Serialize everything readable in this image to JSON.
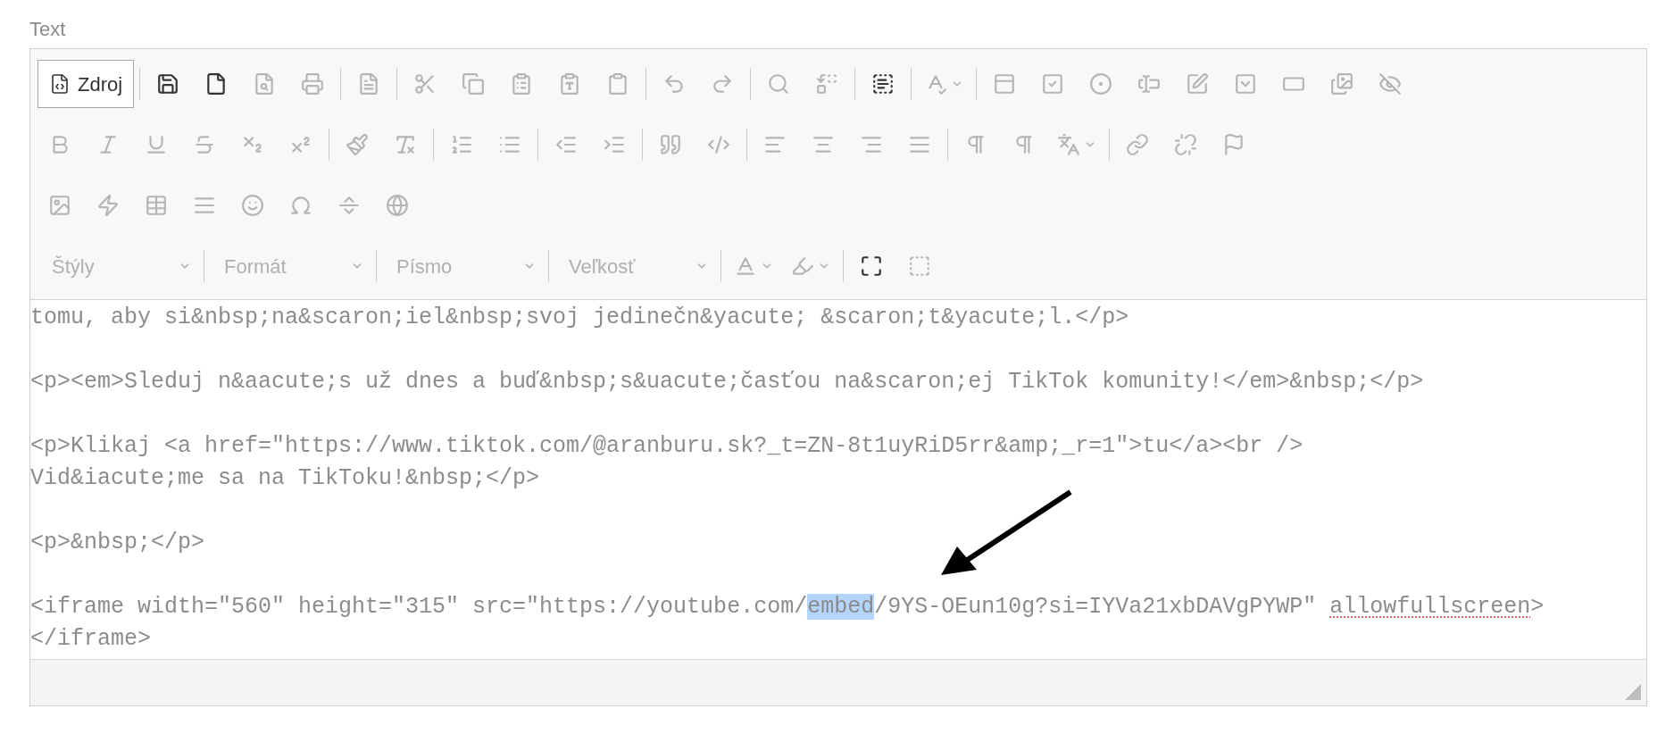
{
  "field_label": "Text",
  "toolbar": {
    "rows": [
      {
        "groups": [
          {
            "items": [
              {
                "kind": "source",
                "label": "Zdroj",
                "on": true,
                "disabled": false
              }
            ]
          },
          {
            "items": [
              {
                "kind": "icon",
                "disabled": false
              },
              {
                "kind": "icon",
                "disabled": false
              },
              {
                "kind": "icon",
                "disabled": true
              },
              {
                "kind": "icon",
                "disabled": true
              }
            ]
          },
          {
            "items": [
              {
                "kind": "icon",
                "disabled": true
              }
            ]
          },
          {
            "items": [
              {
                "kind": "icon",
                "disabled": true
              },
              {
                "kind": "icon",
                "disabled": true
              },
              {
                "kind": "icon",
                "disabled": true
              },
              {
                "kind": "icon",
                "disabled": true
              },
              {
                "kind": "icon",
                "disabled": true
              }
            ]
          },
          {
            "items": [
              {
                "kind": "icon",
                "disabled": true
              },
              {
                "kind": "icon",
                "disabled": true
              }
            ]
          },
          {
            "items": [
              {
                "kind": "icon",
                "disabled": true
              },
              {
                "kind": "icon",
                "disabled": true
              }
            ]
          },
          {
            "items": [
              {
                "kind": "icon",
                "disabled": false
              }
            ]
          },
          {
            "items": [
              {
                "kind": "menu",
                "disabled": true
              }
            ]
          },
          {
            "items": [
              {
                "kind": "icon",
                "disabled": true
              },
              {
                "kind": "icon",
                "disabled": true
              },
              {
                "kind": "icon",
                "disabled": true
              },
              {
                "kind": "icon",
                "disabled": true
              },
              {
                "kind": "icon",
                "disabled": true
              },
              {
                "kind": "icon",
                "disabled": true
              },
              {
                "kind": "icon",
                "disabled": true
              },
              {
                "kind": "icon",
                "disabled": true
              },
              {
                "kind": "icon",
                "disabled": true
              }
            ]
          }
        ]
      },
      {
        "groups": [
          {
            "items": [
              {
                "kind": "icon",
                "disabled": true
              },
              {
                "kind": "icon",
                "disabled": true
              },
              {
                "kind": "icon",
                "disabled": true
              },
              {
                "kind": "icon",
                "disabled": true
              },
              {
                "kind": "icon",
                "disabled": true
              },
              {
                "kind": "icon",
                "disabled": true
              }
            ]
          },
          {
            "items": [
              {
                "kind": "icon",
                "disabled": true
              },
              {
                "kind": "icon",
                "disabled": true
              }
            ]
          },
          {
            "items": [
              {
                "kind": "icon",
                "disabled": true
              },
              {
                "kind": "icon",
                "disabled": true
              }
            ]
          },
          {
            "items": [
              {
                "kind": "icon",
                "disabled": true
              },
              {
                "kind": "icon",
                "disabled": true
              }
            ]
          },
          {
            "items": [
              {
                "kind": "icon",
                "disabled": true
              },
              {
                "kind": "icon",
                "disabled": true
              }
            ]
          },
          {
            "items": [
              {
                "kind": "icon",
                "disabled": true
              },
              {
                "kind": "icon",
                "disabled": true
              },
              {
                "kind": "icon",
                "disabled": true
              },
              {
                "kind": "icon",
                "disabled": true
              }
            ]
          },
          {
            "items": [
              {
                "kind": "icon",
                "disabled": true
              },
              {
                "kind": "icon",
                "disabled": true
              },
              {
                "kind": "menu",
                "disabled": true
              }
            ]
          },
          {
            "items": [
              {
                "kind": "icon",
                "disabled": true
              },
              {
                "kind": "icon",
                "disabled": true
              },
              {
                "kind": "icon",
                "disabled": true
              }
            ]
          }
        ]
      },
      {
        "groups": [
          {
            "items": [
              {
                "kind": "icon",
                "disabled": true
              },
              {
                "kind": "icon",
                "disabled": true
              },
              {
                "kind": "icon",
                "disabled": true
              },
              {
                "kind": "icon",
                "disabled": true
              },
              {
                "kind": "icon",
                "disabled": true
              },
              {
                "kind": "icon",
                "disabled": true
              },
              {
                "kind": "icon",
                "disabled": true
              },
              {
                "kind": "icon",
                "disabled": true
              }
            ]
          }
        ]
      },
      {
        "groups": [
          {
            "items": [
              {
                "kind": "dropdown",
                "placeholder": "Štýly",
                "disabled": true
              }
            ]
          },
          {
            "items": [
              {
                "kind": "dropdown",
                "placeholder": "Formát",
                "disabled": true
              }
            ]
          },
          {
            "items": [
              {
                "kind": "dropdown",
                "placeholder": "Písmo",
                "disabled": true
              }
            ]
          },
          {
            "items": [
              {
                "kind": "dropdown",
                "placeholder": "Veľkosť",
                "disabled": true
              }
            ]
          },
          {
            "items": [
              {
                "kind": "menu",
                "disabled": true
              },
              {
                "kind": "menu",
                "disabled": true
              }
            ]
          },
          {
            "items": [
              {
                "kind": "icon",
                "disabled": false
              },
              {
                "kind": "icon",
                "disabled": true
              }
            ]
          }
        ]
      }
    ]
  },
  "code_blocks": [
    {
      "lines": [
        [
          {
            "text": "tomu, aby si&nbsp;na&scaron;iel&nbsp;svoj jedinečn&yacute; &scaron;t&yacute;l.</p>",
            "kind": "plain"
          }
        ]
      ]
    },
    {
      "lines": [
        [
          {
            "text": "<p><em>Sleduj n&aacute;s už dnes a buď&nbsp;s&uacute;časťou na&scaron;ej TikTok komunity!</em>&nbsp;</p>",
            "kind": "plain"
          }
        ]
      ]
    },
    {
      "lines": [
        [
          {
            "text": "<p>Klikaj <a href=\"https://www.tiktok.com/@aranburu.sk?_t=ZN-8t1uyRiD5rr&amp;_r=1\">tu</a><br />",
            "kind": "plain"
          }
        ],
        [
          {
            "text": "Vid&iacute;me sa na TikToku!&nbsp;</p>",
            "kind": "plain"
          }
        ]
      ]
    },
    {
      "lines": [
        [
          {
            "text": "<p>&nbsp;</p>",
            "kind": "plain"
          }
        ]
      ]
    },
    {
      "lines": [
        [
          {
            "text": "<iframe width=\"560\" height=\"315\" src=\"https://youtube.com/",
            "kind": "plain"
          },
          {
            "text": "embed",
            "kind": "selected"
          },
          {
            "text": "/9YS-OEun10g?si=IYVa21xbDAVgPYWP\" ",
            "kind": "plain"
          },
          {
            "text": "allowfullscreen",
            "kind": "misspelled"
          },
          {
            "text": ">",
            "kind": "plain"
          }
        ],
        [
          {
            "text": "</iframe>",
            "kind": "plain"
          }
        ]
      ]
    }
  ]
}
